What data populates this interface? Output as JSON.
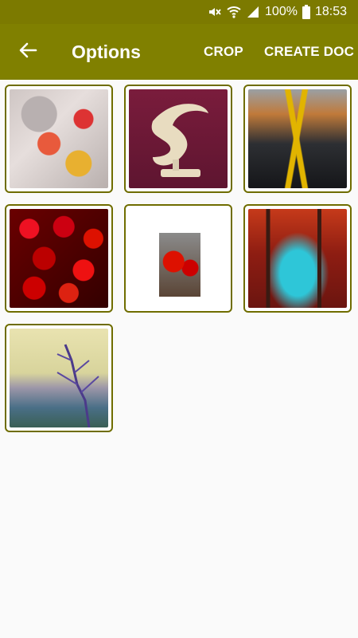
{
  "status_bar": {
    "battery": "100%",
    "time": "18:53",
    "icons": [
      "mute-icon",
      "wifi-icon",
      "signal-icon",
      "battery-icon"
    ]
  },
  "app_bar": {
    "title": "Options",
    "back_icon": "back-arrow-icon",
    "actions": {
      "crop": "CROP",
      "create_doc": "CREATE DOC"
    }
  },
  "gallery": {
    "items": [
      {
        "name": "floral-pattern"
      },
      {
        "name": "dolphin-sculpture"
      },
      {
        "name": "autumn-road"
      },
      {
        "name": "cherries"
      },
      {
        "name": "cherries-small"
      },
      {
        "name": "red-forest"
      },
      {
        "name": "tree-lake"
      }
    ]
  },
  "colors": {
    "status_bar": "#7c7a00",
    "app_bar": "#808000",
    "border": "#6f6d00",
    "background": "#fafafa"
  }
}
